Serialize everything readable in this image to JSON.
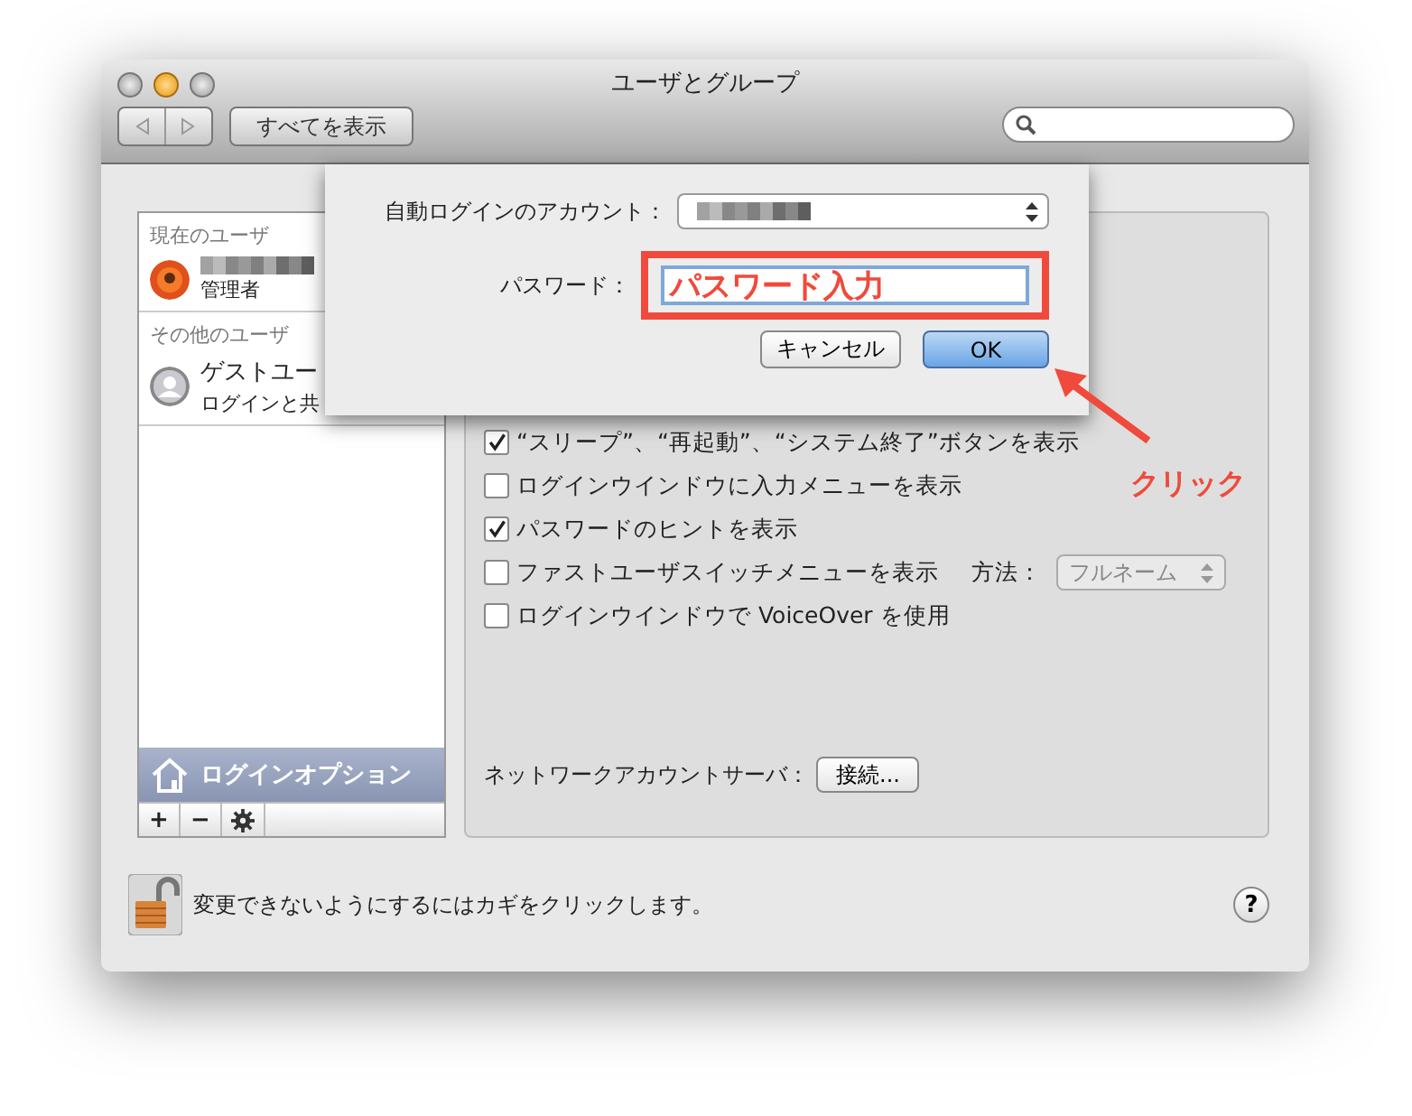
{
  "window": {
    "title": "ユーザとグループ"
  },
  "toolbar": {
    "show_all": "すべてを表示"
  },
  "sidebar": {
    "sections": [
      {
        "header": "現在のユーザ",
        "users": [
          {
            "kind": "admin",
            "detail": "管理者"
          }
        ]
      },
      {
        "header": "その他のユーザ",
        "users": [
          {
            "kind": "guest",
            "name": "ゲストユー",
            "detail": "ログインと共"
          }
        ]
      }
    ],
    "login_options": {
      "label": "ログインオプション",
      "selected": true
    },
    "buttons": [
      "+",
      "−"
    ]
  },
  "options": [
    {
      "label": "“スリープ”、“再起動”、“システム終了”ボタンを表示",
      "checked": true
    },
    {
      "label": "ログインウインドウに入力メニューを表示",
      "checked": false
    },
    {
      "label": "パスワードのヒントを表示",
      "checked": true
    },
    {
      "label": "ファストユーザスイッチメニューを表示",
      "checked": false,
      "method": {
        "label": "方法：",
        "value": "フルネーム"
      }
    },
    {
      "label": "ログインウインドウで VoiceOver を使用",
      "checked": false
    }
  ],
  "network": {
    "label": "ネットワークアカウントサーバ：",
    "button": "接続..."
  },
  "lock_text": "変更できないようにするにはカギをクリックします。",
  "help": "?",
  "sheet": {
    "account_label": "自動ログインのアカウント：",
    "password_label": "パスワード：",
    "password_value": "パスワード入力",
    "cancel": "キャンセル",
    "ok": "OK"
  },
  "annotation": {
    "text": "クリック"
  }
}
